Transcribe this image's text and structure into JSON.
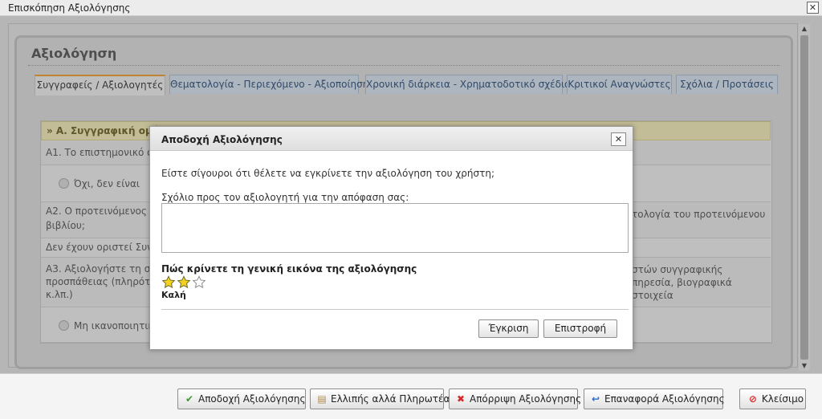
{
  "window": {
    "title": "Επισκόπηση Αξιολόγησης",
    "close_glyph": "✕"
  },
  "panel": {
    "title": "Αξιολόγηση"
  },
  "tabs": [
    {
      "label": "Συγγραφείς / Αξιολογητές",
      "active": true
    },
    {
      "label": "Θεματολογία - Περιεχόμενο - Αξιοποίηση",
      "active": false
    },
    {
      "label": "Χρονική διάρκεια - Χρηματοδοτικό σχέδιο",
      "active": false
    },
    {
      "label": "Κριτικοί Αναγνώστες",
      "active": false
    },
    {
      "label": "Σχόλια / Προτάσεις",
      "active": false
    }
  ],
  "form": {
    "section_title": "» Α. Συγγραφική ομάδα",
    "q1": {
      "left": "Α1. Το επιστημονικό α",
      "option_left": "Όχι, δεν είναι"
    },
    "q2": {
      "left": "Α2. Ο προτεινόμενος α",
      "left_cont": "βιβλίου;",
      "right": "τολογία του προτεινόμενου"
    },
    "note": "Δεν έχουν οριστεί Συν-σ",
    "q3": {
      "left": "Α3. Αξιολογήστε τη σύ",
      "left_cont1": "προσπάθειας (πληρότη",
      "left_cont2": "κ.λπ.)",
      "right1": "στών συγγραφικής",
      "right2": "πηρεσία, βιογραφικά στοιχεία",
      "option_left": "Μη ικανοποιητική"
    }
  },
  "dialog": {
    "title": "Αποδοχή Αξιολόγησης",
    "close_glyph": "✕",
    "question": "Είστε σίγουροι ότι θέλετε να εγκρίνετε την αξιολόγηση του χρήστη;",
    "comment_label": "Σχόλιο προς τον αξιολογητή για την απόφαση σας:",
    "comment_value": "",
    "rating_label": "Πώς κρίνετε τη γενική εικόνα της αξιολόγησης",
    "rating": {
      "value": 2,
      "max": 3,
      "text": "Καλή"
    },
    "approve_label": "Έγκριση",
    "back_label": "Επιστροφή"
  },
  "footer": {
    "buttons": [
      {
        "label": "Αποδοχή Αξιολόγησης",
        "icon": "check-icon",
        "color": "#3a9a2a"
      },
      {
        "label": "Ελλιπής αλλά Πληρωτέα",
        "icon": "scroll-icon",
        "color": "#b08a4a"
      },
      {
        "label": "Απόρριψη Αξιολόγησης",
        "icon": "cross-icon",
        "color": "#d62a2a"
      },
      {
        "label": "Επαναφορά Αξιολόγησης",
        "icon": "undo-icon",
        "color": "#2a6ad0"
      },
      {
        "label": "Κλείσιμο",
        "icon": "no-entry-icon",
        "color": "#d62a2a"
      }
    ]
  }
}
